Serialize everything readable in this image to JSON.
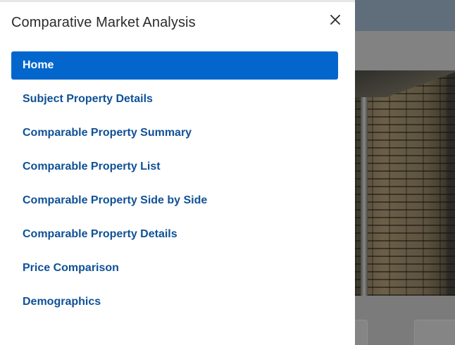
{
  "drawer": {
    "title": "Comparative Market Analysis",
    "close_icon": "close-icon",
    "nav_items": [
      {
        "label": "Home",
        "active": true
      },
      {
        "label": "Subject Property Details",
        "active": false
      },
      {
        "label": "Comparable Property Summary",
        "active": false
      },
      {
        "label": "Comparable Property List",
        "active": false
      },
      {
        "label": "Comparable Property Side by Side",
        "active": false
      },
      {
        "label": "Comparable Property Details",
        "active": false
      },
      {
        "label": "Price Comparison",
        "active": false
      },
      {
        "label": "Demographics",
        "active": false
      }
    ]
  },
  "colors": {
    "active_bg": "#0366cc",
    "link": "#0f5196",
    "title": "#2b2b2b"
  }
}
